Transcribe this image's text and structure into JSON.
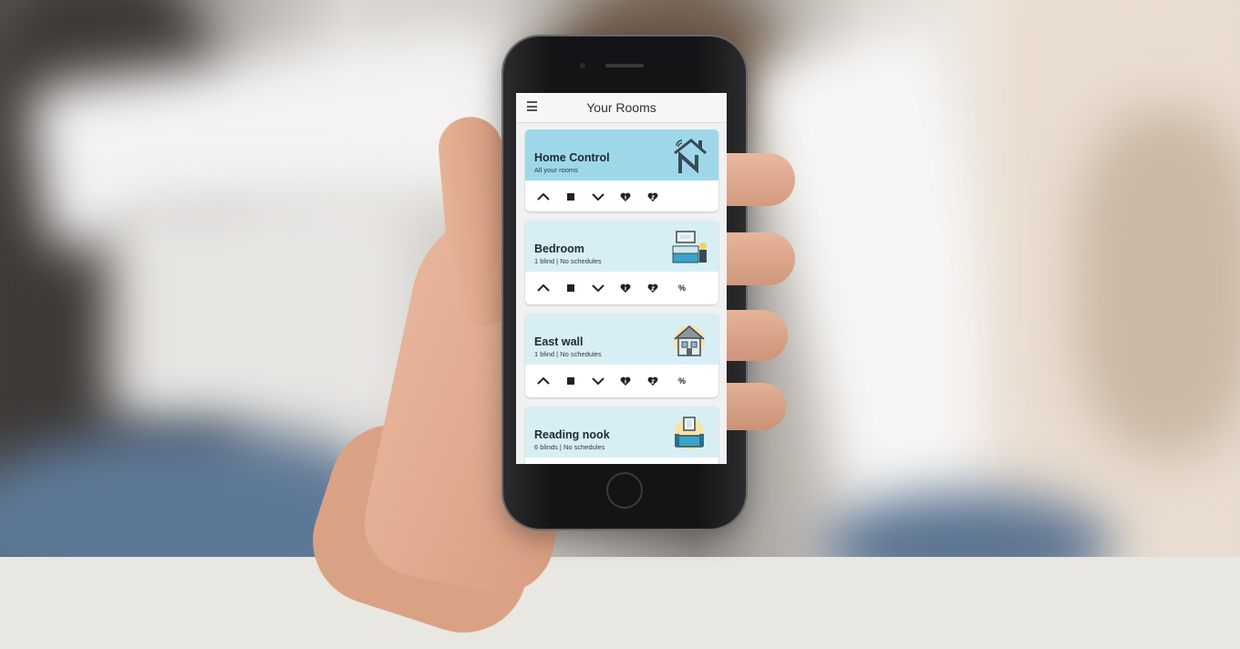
{
  "app": {
    "title": "Your Rooms"
  },
  "rooms": [
    {
      "name": "Home Control",
      "subtitle": "All your rooms",
      "icon": "home-control-logo-icon",
      "active": true,
      "has_percent": false
    },
    {
      "name": "Bedroom",
      "subtitle": "1 blind | No schedules",
      "icon": "bedroom-icon",
      "active": false,
      "has_percent": true,
      "percent_label": "%"
    },
    {
      "name": "East wall",
      "subtitle": "1 blind | No schedules",
      "icon": "house-icon",
      "active": false,
      "has_percent": true,
      "percent_label": "%"
    },
    {
      "name": "Reading nook",
      "subtitle": "6 blinds | No schedules",
      "icon": "armchair-icon",
      "active": false,
      "has_percent": false
    }
  ],
  "controls": [
    "chevron-up-icon",
    "stop-square-icon",
    "chevron-down-icon",
    "favourite-1-icon",
    "favourite-2-icon"
  ],
  "colors": {
    "active_header": "#9ed8e8",
    "room_header": "#d8eef5",
    "card_bg": "#ffffff",
    "screen_bg": "#f1f1f1"
  }
}
